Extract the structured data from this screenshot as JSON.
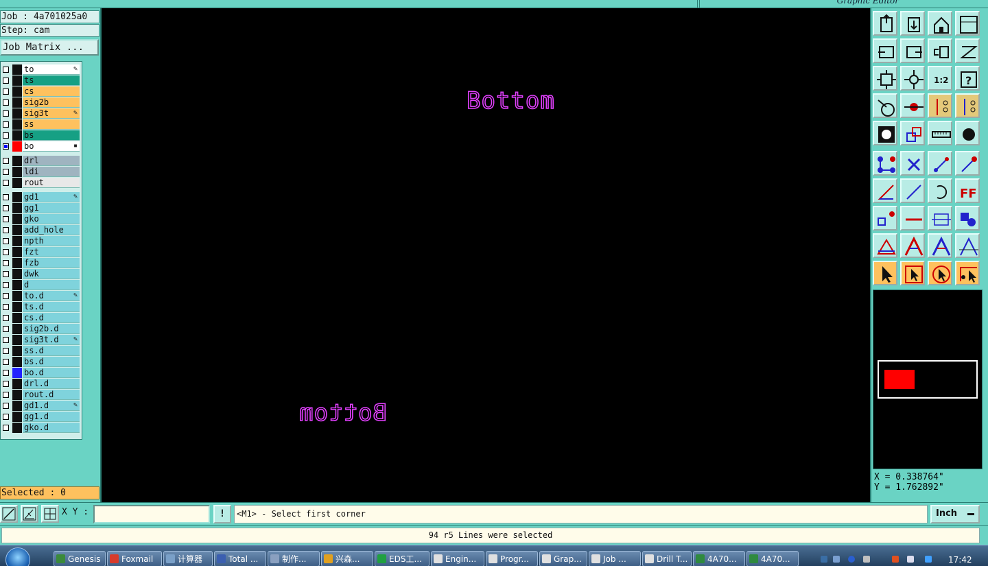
{
  "window": {
    "title": "Graphic Editor"
  },
  "job": {
    "job_label": "Job : 4a701025a0",
    "step_label": "Step: cam",
    "matrix_button": "Job Matrix ..."
  },
  "layers": [
    {
      "name": "to",
      "color": "#ffffff",
      "mark": "✎",
      "group": 0
    },
    {
      "name": "ts",
      "color": "#16a084",
      "mark": "",
      "group": 0
    },
    {
      "name": "cs",
      "color": "#fec15e",
      "mark": "",
      "group": 0
    },
    {
      "name": "sig2b",
      "color": "#fec15e",
      "mark": "",
      "group": 0
    },
    {
      "name": "sig3t",
      "color": "#fec15e",
      "mark": "✎",
      "group": 0
    },
    {
      "name": "ss",
      "color": "#fec15e",
      "mark": "",
      "group": 0
    },
    {
      "name": "bs",
      "color": "#16a084",
      "mark": "",
      "group": 0
    },
    {
      "name": "bo",
      "color": "#ffffff",
      "mark": "▪",
      "group": 0,
      "active": true,
      "swatch": "#ff0000"
    },
    {
      "name": "drl",
      "color": "#9fb4c0",
      "mark": "",
      "group": 1
    },
    {
      "name": "ldi",
      "color": "#9fb4c0",
      "mark": "",
      "group": 1
    },
    {
      "name": "rout",
      "color": "#e8e8e8",
      "mark": "",
      "group": 1
    },
    {
      "name": "gd1",
      "color": "#7fd3dc",
      "mark": "✎",
      "group": 2
    },
    {
      "name": "gg1",
      "color": "#7fd3dc",
      "mark": "",
      "group": 2
    },
    {
      "name": "gko",
      "color": "#7fd3dc",
      "mark": "",
      "group": 2
    },
    {
      "name": "add_hole",
      "color": "#7fd3dc",
      "mark": "",
      "group": 2
    },
    {
      "name": "npth",
      "color": "#7fd3dc",
      "mark": "",
      "group": 2
    },
    {
      "name": "fzt",
      "color": "#7fd3dc",
      "mark": "",
      "group": 2
    },
    {
      "name": "fzb",
      "color": "#7fd3dc",
      "mark": "",
      "group": 2
    },
    {
      "name": "dwk",
      "color": "#7fd3dc",
      "mark": "",
      "group": 2
    },
    {
      "name": "d",
      "color": "#7fd3dc",
      "mark": "",
      "group": 2
    },
    {
      "name": "to.d",
      "color": "#7fd3dc",
      "mark": "✎",
      "group": 2
    },
    {
      "name": "ts.d",
      "color": "#7fd3dc",
      "mark": "",
      "group": 2
    },
    {
      "name": "cs.d",
      "color": "#7fd3dc",
      "mark": "",
      "group": 2
    },
    {
      "name": "sig2b.d",
      "color": "#7fd3dc",
      "mark": "",
      "group": 2
    },
    {
      "name": "sig3t.d",
      "color": "#7fd3dc",
      "mark": "✎",
      "group": 2
    },
    {
      "name": "ss.d",
      "color": "#7fd3dc",
      "mark": "",
      "group": 2
    },
    {
      "name": "bs.d",
      "color": "#7fd3dc",
      "mark": "",
      "group": 2
    },
    {
      "name": "bo.d",
      "color": "#7fd3dc",
      "mark": "",
      "group": 2,
      "swatch": "#2222ff"
    },
    {
      "name": "drl.d",
      "color": "#7fd3dc",
      "mark": "",
      "group": 2
    },
    {
      "name": "rout.d",
      "color": "#7fd3dc",
      "mark": "",
      "group": 2
    },
    {
      "name": "gd1.d",
      "color": "#7fd3dc",
      "mark": "✎",
      "group": 2
    },
    {
      "name": "gg1.d",
      "color": "#7fd3dc",
      "mark": "",
      "group": 2
    },
    {
      "name": "gko.d",
      "color": "#7fd3dc",
      "mark": "",
      "group": 2
    }
  ],
  "selected_label": "Selected : 0",
  "canvas": {
    "text_top": "Bottom",
    "text_mirrored": "Bottom",
    "text_color": "#e040fb",
    "text_color2": "#4040ff"
  },
  "toolbar_icons": [
    "open-job-icon",
    "save-icon",
    "home-icon",
    "window-icon",
    "pan-left-icon",
    "pan-right-icon",
    "pan-reverse-icon",
    "snap-icon",
    "zoom-fit-icon",
    "zoom-center-icon",
    "scale-1-2-icon",
    "help-icon",
    "palette-icon",
    "display-icon",
    "layers-red-icon",
    "layers-blue-icon",
    "pad-icon",
    "surface-icon",
    "measure-icon",
    "drill-icon",
    "net-select-icon",
    "delete-icon",
    "line-icon",
    "line-red-icon",
    "angle-icon",
    "slash-icon",
    "arc-icon",
    "text-f-icon",
    "pad-move-icon",
    "line-minus-icon",
    "resize-icon",
    "copy-shape-icon",
    "mountain-icon",
    "mountain-a-icon",
    "mountain-a2-icon",
    "mountain-a3-icon",
    "pointer-icon",
    "pointer-box-icon",
    "pointer-rotate-icon",
    "pointer-net-icon"
  ],
  "coords": {
    "x_label": "X = 0.338764\"",
    "y_label": "Y = 1.762892\""
  },
  "command": {
    "xy_label": "X Y :",
    "xy_value": "",
    "bang": "!",
    "prompt": "<M1> - Select first corner",
    "units": "Inch"
  },
  "status_message": "94 r5 Lines were selected",
  "taskbar": {
    "items": [
      {
        "label": "Genesis",
        "color": "#3b8a3b"
      },
      {
        "label": "Foxmail",
        "color": "#d83b2b"
      },
      {
        "label": "计算器",
        "color": "#7aa0c8"
      },
      {
        "label": "Total ...",
        "color": "#3b5fb0"
      },
      {
        "label": "制作...",
        "color": "#8aa0c0"
      },
      {
        "label": "兴森...",
        "color": "#e0a020"
      },
      {
        "label": "EDS工...",
        "color": "#20a040"
      },
      {
        "label": "Engin...",
        "color": "#e0e0e0"
      },
      {
        "label": "Progr...",
        "color": "#e0e0e0"
      },
      {
        "label": "Grap...",
        "color": "#e0e0e0"
      },
      {
        "label": "Job ...",
        "color": "#e0e0e0"
      },
      {
        "label": "Drill T...",
        "color": "#e0e0e0"
      },
      {
        "label": "4A70...",
        "color": "#2f8a3f"
      },
      {
        "label": "4A70...",
        "color": "#2f8a3f"
      }
    ],
    "clock": "17:42"
  }
}
